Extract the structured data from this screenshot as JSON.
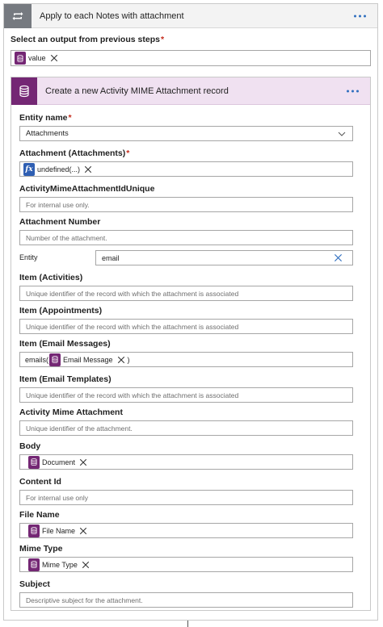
{
  "loop": {
    "title": "Apply to each Notes with attachment",
    "select_label": "Select an output from previous steps",
    "select_token": "value"
  },
  "action": {
    "title": "Create a new Activity MIME Attachment record",
    "fields": {
      "entity_name_label": "Entity name",
      "entity_name_value": "Attachments",
      "attachment_label": "Attachment (Attachments)",
      "attachment_token": "undefined(...)",
      "mime_unique_label": "ActivityMimeAttachmentIdUnique",
      "mime_unique_placeholder": "For internal use only.",
      "attachment_number_label": "Attachment Number",
      "attachment_number_placeholder": "Number of the attachment.",
      "entity_label": "Entity",
      "entity_value": "email",
      "item_activities_label": "Item (Activities)",
      "item_activities_placeholder": "Unique identifier of the record with which the attachment is associated",
      "item_appointments_label": "Item (Appointments)",
      "item_appointments_placeholder": "Unique identifier of the record with which the attachment is associated",
      "item_email_messages_label": "Item (Email Messages)",
      "item_email_prefix": "emails(",
      "item_email_token": "Email Message",
      "item_email_suffix": ")",
      "item_email_templates_label": "Item (Email Templates)",
      "item_email_templates_placeholder": "Unique identifier of the record with which the attachment is associated",
      "activity_mime_label": "Activity Mime Attachment",
      "activity_mime_placeholder": "Unique identifier of the attachment.",
      "body_label": "Body",
      "body_token": "Document",
      "content_id_label": "Content Id",
      "content_id_placeholder": "For internal use only",
      "file_name_label": "File Name",
      "file_name_token": "File Name",
      "mime_type_label": "Mime Type",
      "mime_type_token": "Mime Type",
      "subject_label": "Subject",
      "subject_placeholder": "Descriptive subject for the attachment."
    }
  },
  "colors": {
    "loop_header": "#767a80",
    "action_accent": "#742774",
    "action_header_bg": "#f0e1f1",
    "fx_token": "#2f5fb3",
    "link_blue": "#2f6fbf",
    "required": "#c42b1c"
  },
  "icons": {
    "loop": "loop-arrows-icon",
    "action": "database-icon",
    "menu": "more-dots-icon",
    "token_remove": "close-icon",
    "dropdown": "chevron-down-icon"
  }
}
